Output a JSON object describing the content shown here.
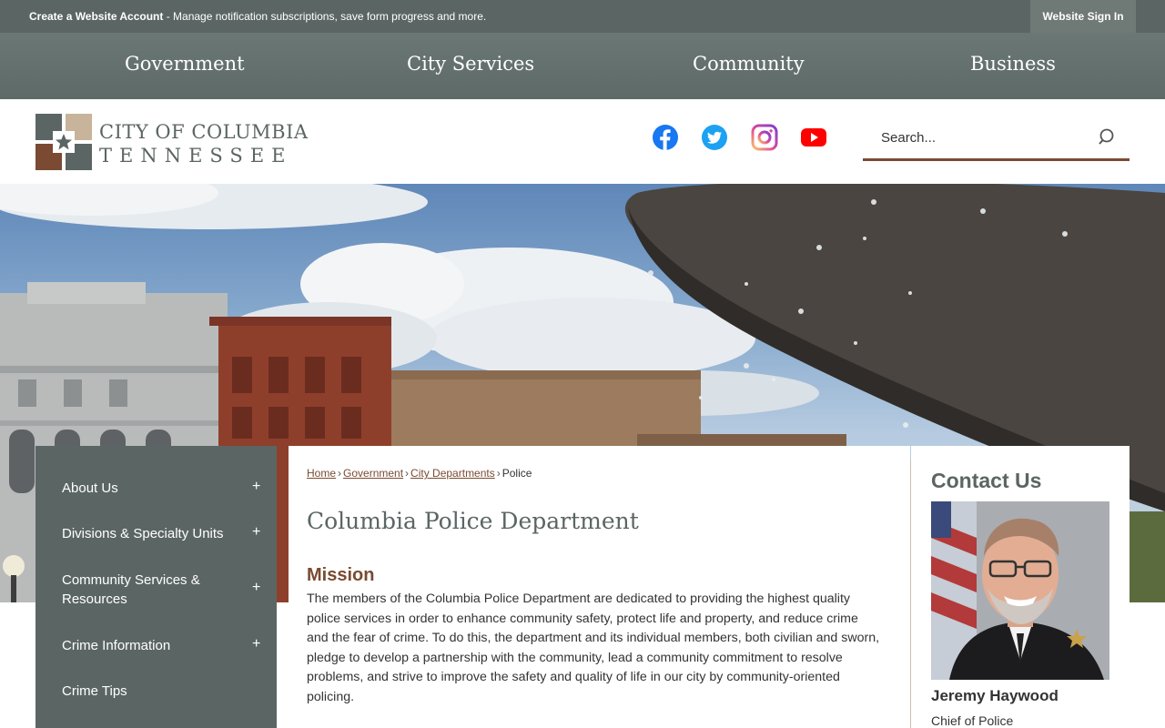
{
  "topbar": {
    "account_link": "Create a Website Account",
    "account_desc": " - Manage notification subscriptions, save form progress and more.",
    "signin": "Website Sign In"
  },
  "nav": {
    "items": [
      "Government",
      "City Services",
      "Community",
      "Business"
    ]
  },
  "logo": {
    "line1": "CITY OF COLUMBIA",
    "line2": "TENNESSEE",
    "colors": [
      "#5b6664",
      "#c7b49a",
      "#7a4a32",
      "#5b6664"
    ]
  },
  "social": [
    {
      "icon": "facebook-icon",
      "color": "#1877f2"
    },
    {
      "icon": "twitter-icon",
      "color": "#1da1f2"
    },
    {
      "icon": "instagram-icon",
      "color": "#d6249f"
    },
    {
      "icon": "youtube-icon",
      "color": "#ff0000"
    }
  ],
  "search": {
    "placeholder": "Search..."
  },
  "sidenav": {
    "items": [
      {
        "label": "About Us",
        "expandable": true
      },
      {
        "label": "Divisions & Specialty Units",
        "expandable": true
      },
      {
        "label": "Community Services & Resources",
        "expandable": true
      },
      {
        "label": "Crime Information",
        "expandable": true
      },
      {
        "label": "Crime Tips",
        "expandable": false
      }
    ],
    "expand_symbol": "+"
  },
  "breadcrumb": {
    "links": [
      "Home",
      "Government",
      "City Departments"
    ],
    "current": "Police",
    "separator": "›"
  },
  "page": {
    "title": "Columbia Police Department",
    "mission_heading": "Mission",
    "mission_text": "The members of the Columbia Police Department are dedicated to providing the highest quality police services in order to enhance community safety, protect life and property, and reduce crime and the fear of crime. To do this, the department and its individual members, both civilian and sworn, pledge to develop a partnership with the community, lead a community commitment to resolve problems, and strive to improve the safety and quality of life in our city by community-oriented policing."
  },
  "contact": {
    "title": "Contact Us",
    "name": "Jeremy Haywood",
    "role": "Chief of Police"
  },
  "colors": {
    "primary": "#5b6664",
    "accent": "#7a4a32",
    "tan": "#c7b49a"
  }
}
